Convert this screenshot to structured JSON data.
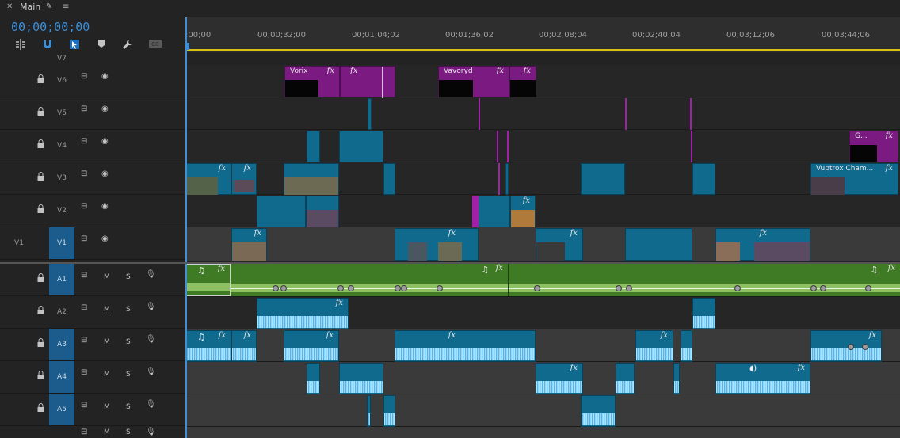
{
  "panel": {
    "title": "Main"
  },
  "timecode": "00;00;00;00",
  "ruler": {
    "labels": [
      ";00;00",
      "00;00;32;00",
      "00;01;04;02",
      "00;01;36;02",
      "00;02;08;04",
      "00;02;40;04",
      "00;03;12;06",
      "00;03;44;06"
    ]
  },
  "tracks": {
    "video": [
      "V7",
      "V6",
      "V5",
      "V4",
      "V3",
      "V2",
      "V1"
    ],
    "audio": [
      "A1",
      "A2",
      "A3",
      "A4",
      "A5"
    ],
    "source_video": "V1",
    "mute_label": "M",
    "solo_label": "S"
  },
  "clips": {
    "v6_a": "Vorix",
    "v6_b": "Vavoryd",
    "v4_a": "G...",
    "v3_a": "Vuptrox Cham...",
    "fx": "fx"
  },
  "colors": {
    "accent": "#3d8fd8",
    "video_clip": "#0f6a8e",
    "graphic_clip": "#7b1b82",
    "audio_clip": "#3f7a25",
    "work_area": "#d9c20f"
  }
}
